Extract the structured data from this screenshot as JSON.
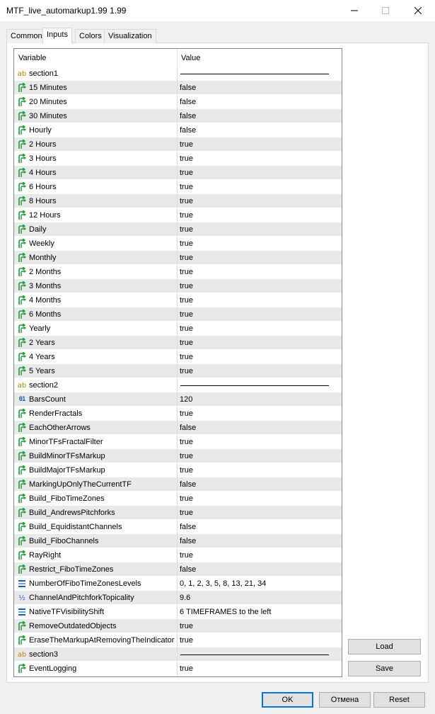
{
  "window": {
    "title": "MTF_live_automarkup1.99 1.99"
  },
  "tabs": [
    {
      "label": "Common",
      "active": false
    },
    {
      "label": "Inputs",
      "active": true
    },
    {
      "label": "Colors",
      "active": false
    },
    {
      "label": "Visualization",
      "active": false
    }
  ],
  "grid": {
    "header": {
      "variable": "Variable",
      "value": "Value"
    },
    "rows": [
      {
        "icon": "ab-section-icon",
        "name": "section1",
        "value": "",
        "kind": "section"
      },
      {
        "icon": "bool-arrow-icon",
        "name": "15 Minutes",
        "value": "false"
      },
      {
        "icon": "bool-arrow-icon",
        "name": "20 Minutes",
        "value": "false"
      },
      {
        "icon": "bool-arrow-icon",
        "name": "30 Minutes",
        "value": "false"
      },
      {
        "icon": "bool-arrow-icon",
        "name": "Hourly",
        "value": "false"
      },
      {
        "icon": "bool-arrow-icon",
        "name": "2 Hours",
        "value": "true"
      },
      {
        "icon": "bool-arrow-icon",
        "name": "3 Hours",
        "value": "true"
      },
      {
        "icon": "bool-arrow-icon",
        "name": "4 Hours",
        "value": "true"
      },
      {
        "icon": "bool-arrow-icon",
        "name": "6 Hours",
        "value": "true"
      },
      {
        "icon": "bool-arrow-icon",
        "name": "8 Hours",
        "value": "true"
      },
      {
        "icon": "bool-arrow-icon",
        "name": "12 Hours",
        "value": "true"
      },
      {
        "icon": "bool-arrow-icon",
        "name": "Daily",
        "value": "true"
      },
      {
        "icon": "bool-arrow-icon",
        "name": "Weekly",
        "value": "true"
      },
      {
        "icon": "bool-arrow-icon",
        "name": "Monthly",
        "value": "true"
      },
      {
        "icon": "bool-arrow-icon",
        "name": "2 Months",
        "value": "true"
      },
      {
        "icon": "bool-arrow-icon",
        "name": "3 Months",
        "value": "true"
      },
      {
        "icon": "bool-arrow-icon",
        "name": "4 Months",
        "value": "true"
      },
      {
        "icon": "bool-arrow-icon",
        "name": "6 Months",
        "value": "true"
      },
      {
        "icon": "bool-arrow-icon",
        "name": "Yearly",
        "value": "true"
      },
      {
        "icon": "bool-arrow-icon",
        "name": "2 Years",
        "value": "true"
      },
      {
        "icon": "bool-arrow-icon",
        "name": "4 Years",
        "value": "true"
      },
      {
        "icon": "bool-arrow-icon",
        "name": "5 Years",
        "value": "true"
      },
      {
        "icon": "ab-section-icon",
        "name": "section2",
        "value": "",
        "kind": "section"
      },
      {
        "icon": "int-icon",
        "name": "BarsCount",
        "value": "120"
      },
      {
        "icon": "bool-arrow-icon",
        "name": "RenderFractals",
        "value": "true"
      },
      {
        "icon": "bool-arrow-icon",
        "name": "EachOtherArrows",
        "value": "false"
      },
      {
        "icon": "bool-arrow-icon",
        "name": "MinorTFsFractalFilter",
        "value": "true"
      },
      {
        "icon": "bool-arrow-icon",
        "name": "BuildMinorTFsMarkup",
        "value": "true"
      },
      {
        "icon": "bool-arrow-icon",
        "name": "BuildMajorTFsMarkup",
        "value": "true"
      },
      {
        "icon": "bool-arrow-icon",
        "name": "MarkingUpOnlyTheCurrentTF",
        "value": "false"
      },
      {
        "icon": "bool-arrow-icon",
        "name": "Build_FiboTimeZones",
        "value": "true"
      },
      {
        "icon": "bool-arrow-icon",
        "name": "Build_AndrewsPitchforks",
        "value": "true"
      },
      {
        "icon": "bool-arrow-icon",
        "name": "Build_EquidistantChannels",
        "value": "false"
      },
      {
        "icon": "bool-arrow-icon",
        "name": "Build_FiboChannels",
        "value": "false"
      },
      {
        "icon": "bool-arrow-icon",
        "name": "RayRight",
        "value": "true"
      },
      {
        "icon": "bool-arrow-icon",
        "name": "Restrict_FiboTimeZones",
        "value": "false"
      },
      {
        "icon": "enum-list-icon",
        "name": "NumberOfFiboTimeZonesLevels",
        "value": "0, 1, 2, 3, 5, 8, 13, 21, 34"
      },
      {
        "icon": "double-icon",
        "name": "ChannelAndPitchforkTopicality",
        "value": "9.6"
      },
      {
        "icon": "enum-list-icon",
        "name": "NativeTFVisibilityShift",
        "value": "6 TIMEFRAMES to the left"
      },
      {
        "icon": "bool-arrow-icon",
        "name": "RemoveOutdatedObjects",
        "value": "true"
      },
      {
        "icon": "bool-arrow-icon",
        "name": "EraseTheMarkupAtRemovingTheIndicator",
        "value": "true"
      },
      {
        "icon": "ab-section-icon",
        "name": "section3",
        "value": "",
        "kind": "section"
      },
      {
        "icon": "bool-arrow-icon",
        "name": "EventLogging",
        "value": "true"
      }
    ]
  },
  "side_buttons": {
    "load": "Load",
    "save": "Save"
  },
  "footer": {
    "ok": "OK",
    "cancel": "Отмена",
    "reset": "Reset"
  },
  "colors": {
    "arrow_green": "#1e9a3c",
    "row_alt": "#e9e9e9",
    "focus_blue": "#0078d7"
  }
}
